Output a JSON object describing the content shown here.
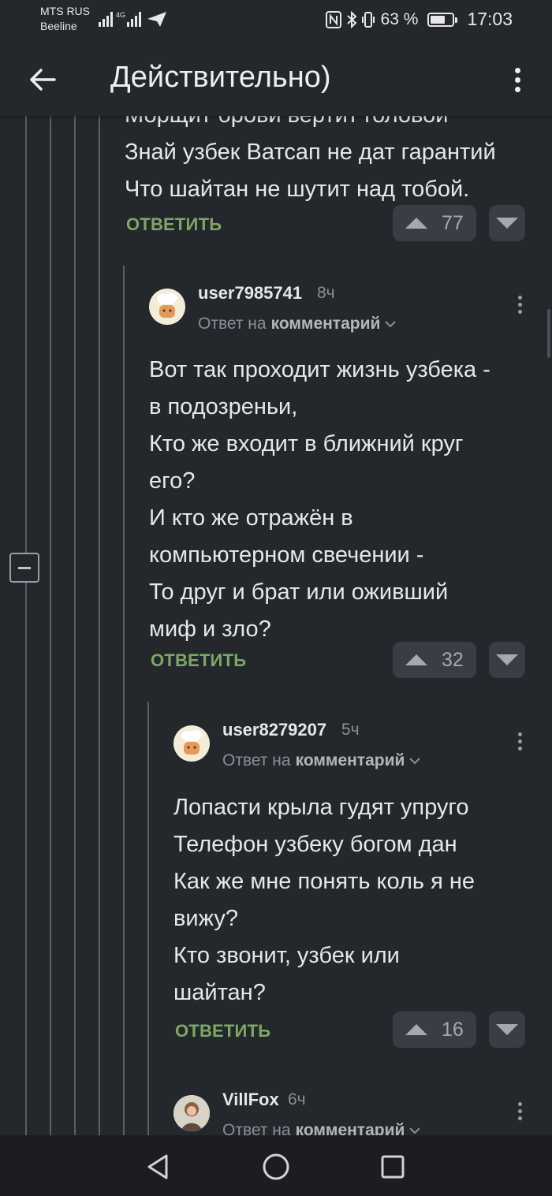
{
  "status_bar": {
    "carrier_primary": "MTS RUS",
    "carrier_secondary": "Beeline",
    "network_label": "4G",
    "battery_percent": "63 %",
    "time": "17:03"
  },
  "header": {
    "title": "Действительно)"
  },
  "comment_tail": {
    "lines": [
      "Морщит брови вертит головой",
      "Знай узбек Ватсап не дат гарантий",
      "Что шайтан не шутит над тобой."
    ],
    "reply_label": "ОТВЕТИТЬ",
    "rating": "77"
  },
  "comments": [
    {
      "username": "user7985741",
      "time": "8ч",
      "reply_prefix": "Ответ на",
      "reply_target": "комментарий",
      "lines": [
        "Вот так проходит жизнь узбека -",
        "в подозреньи,",
        "Кто же входит в ближний круг",
        "его?",
        "И кто же отражён в",
        "компьютерном свечении -",
        "То друг и брат или оживший",
        "миф и зло?"
      ],
      "reply_label": "ОТВЕТИТЬ",
      "rating": "32"
    },
    {
      "username": "user8279207",
      "time": "5ч",
      "reply_prefix": "Ответ на",
      "reply_target": "комментарий",
      "lines": [
        "Лопасти крыла гудят упруго",
        "Телефон узбеку богом дан",
        "Как же мне понять коль я не",
        "вижу?",
        "Кто звонит, узбек или",
        "шайтан?"
      ],
      "reply_label": "ОТВЕТИТЬ",
      "rating": "16"
    },
    {
      "username": "VillFox",
      "time": "6ч",
      "reply_prefix": "Ответ на",
      "reply_target": "комментарий"
    }
  ],
  "colors": {
    "background": "#24282d",
    "accent_green": "#7ca864",
    "vote_bg": "#393e44"
  },
  "icons": {
    "back": "arrow-left-icon",
    "menu": "more-vertical-icon",
    "vote_up": "triangle-up-icon",
    "vote_down": "triangle-down-icon",
    "collapse": "minus-square-icon",
    "nav_back": "triangle-back-icon",
    "nav_home": "circle-home-icon",
    "nav_recent": "square-recent-icon"
  }
}
